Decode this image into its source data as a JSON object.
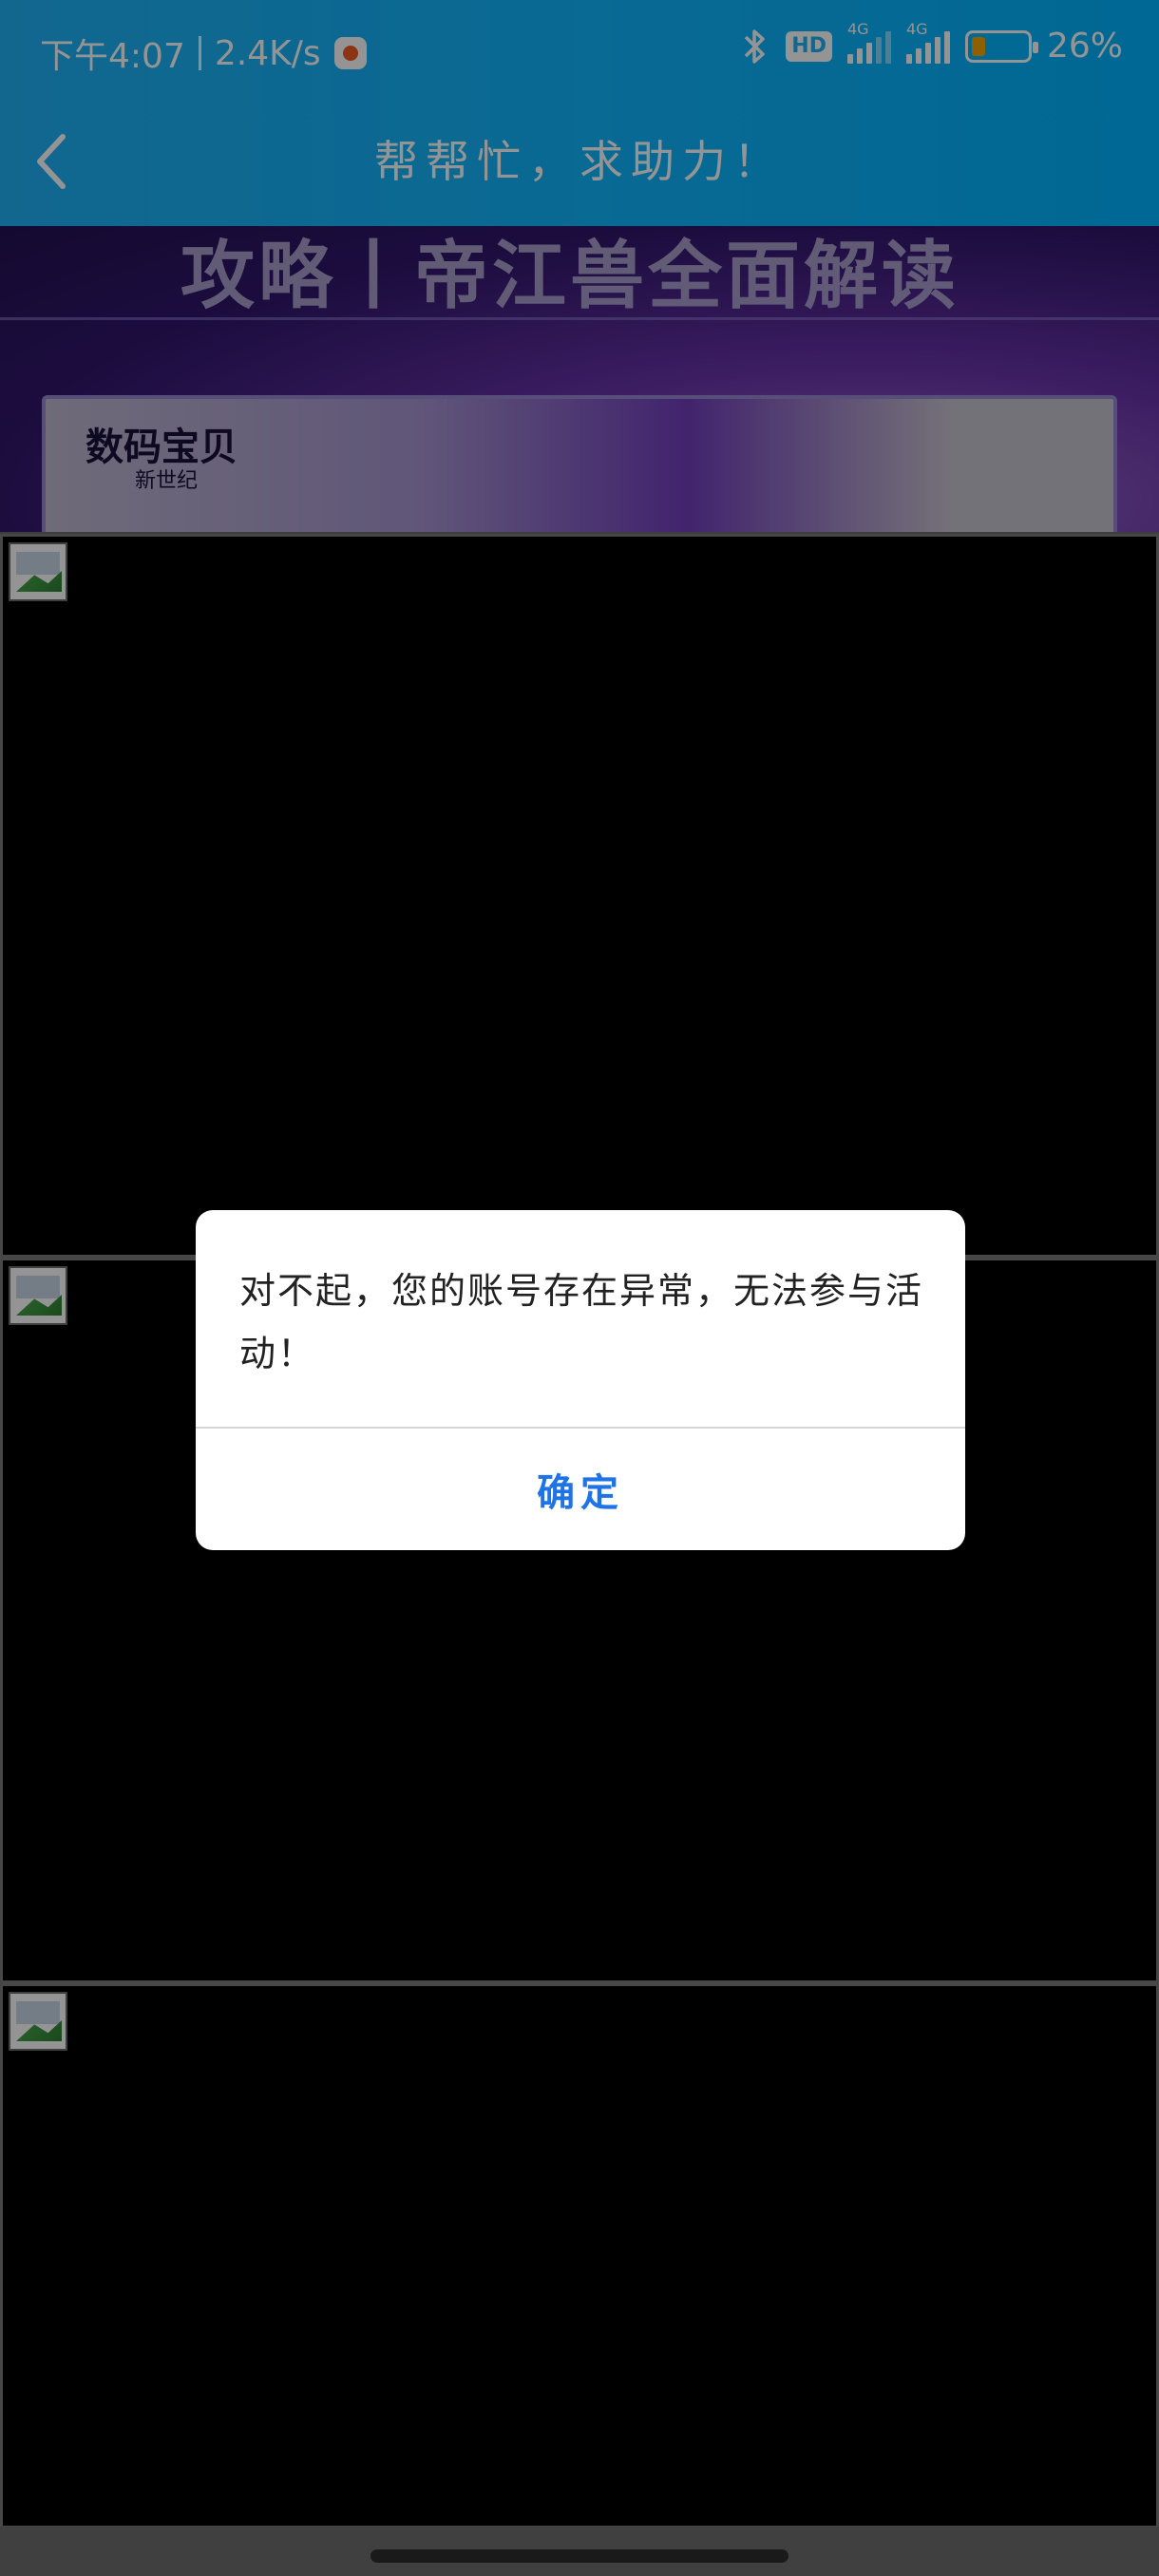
{
  "status_bar": {
    "time": "下午4:07",
    "net_speed": "2.4K/s",
    "hd_label": "HD",
    "sim1_label": "4G",
    "sim2_label": "4G",
    "battery": "26%"
  },
  "header": {
    "title": "帮帮忙，求助力！"
  },
  "banner": {
    "headline": "攻略丨帝江兽全面解读",
    "logo": "数码宝贝",
    "logo_sub": "新世纪"
  },
  "dialog": {
    "message": "对不起，您的账号存在异常，无法参与活动！",
    "confirm": "确定"
  },
  "colors": {
    "header_blue": "#0fb7ff",
    "confirm_blue": "#1e73e6"
  }
}
